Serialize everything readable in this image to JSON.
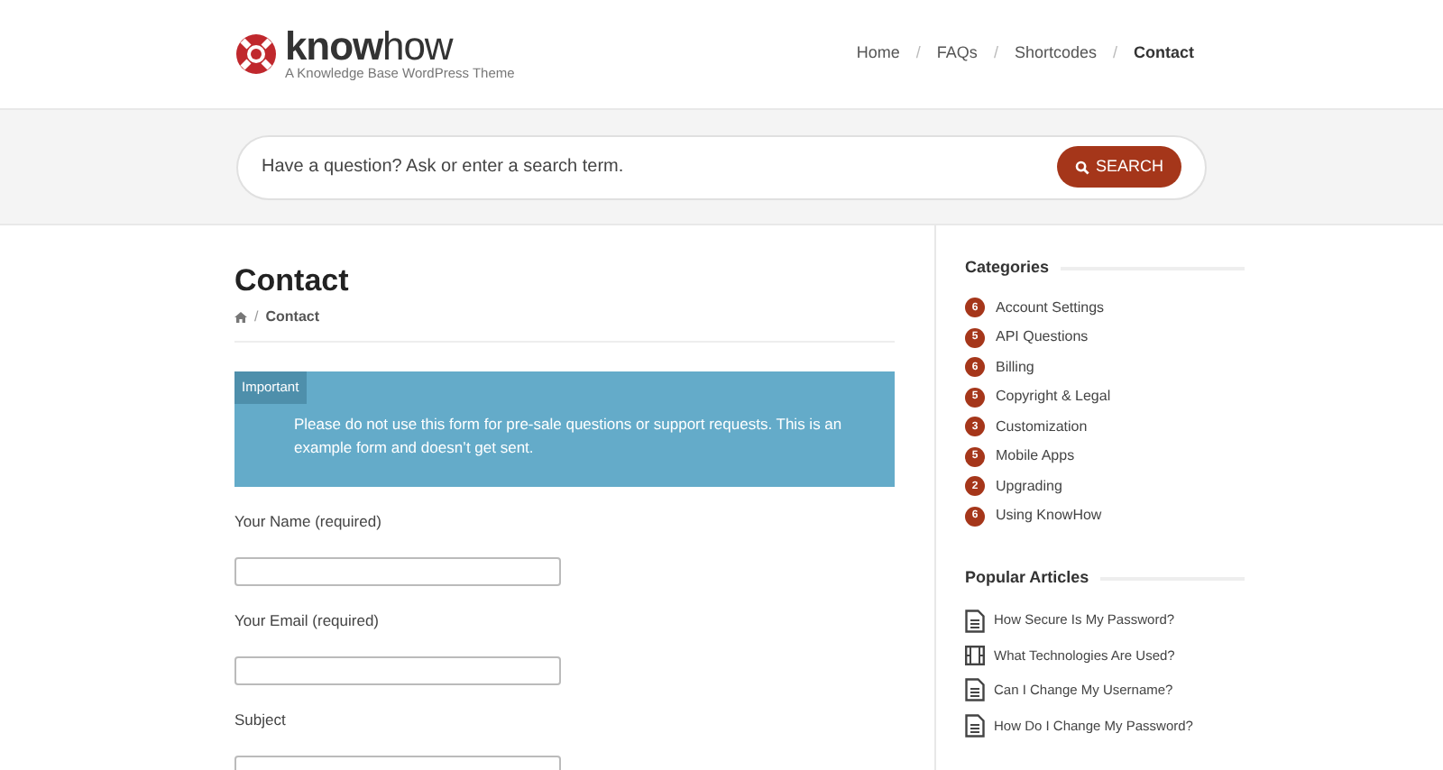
{
  "logo": {
    "name": "**know**how",
    "tagline": "A Knowledge Base WordPress Theme"
  },
  "nav": [
    {
      "label": "Home",
      "selected": false
    },
    {
      "separator": "/",
      "label": "FAQs",
      "selected": false
    },
    {
      "separator": "/",
      "label": "Shortcodes",
      "selected": false
    },
    {
      "separator": "/",
      "label": "Contact",
      "selected": true
    }
  ],
  "search": {
    "placeholder": "Have a question? Ask or enter a search term.",
    "button": "SEARCH"
  },
  "page": {
    "title": "Contact",
    "breadcrumb_separator": "/",
    "breadcrumb": "Contact"
  },
  "notice": {
    "badge": "Important",
    "text": "Please do not use this form for pre-sale questions or support requests. This is an example form and doesn’t get sent."
  },
  "form": [
    {
      "label": "Your Name (required)"
    },
    {
      "label": "Your Email (required)"
    },
    {
      "label": "Subject"
    }
  ],
  "categories": {
    "title": "Categories",
    "items": [
      {
        "count": "6",
        "name": "Account Settings"
      },
      {
        "count": "5",
        "name": "API Questions"
      },
      {
        "count": "6",
        "name": "Billing"
      },
      {
        "count": "5",
        "name": "Copyright & Legal"
      },
      {
        "count": "3",
        "name": "Customization"
      },
      {
        "count": "5",
        "name": "Mobile Apps"
      },
      {
        "count": "2",
        "name": "Upgrading"
      },
      {
        "count": "6",
        "name": "Using KnowHow"
      }
    ]
  },
  "popular": {
    "title": "Popular Articles",
    "items": [
      {
        "kind": "document",
        "title": "How Secure Is My Password?"
      },
      {
        "kind": "video",
        "title": "What Technologies Are Used?"
      },
      {
        "kind": "document",
        "title": "Can I Change My Username?"
      },
      {
        "kind": "document",
        "title": "How Do I Change My Password?"
      }
    ]
  }
}
